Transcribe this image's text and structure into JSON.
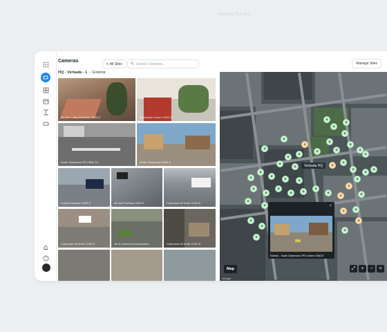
{
  "watermark": "Verkada The Bird",
  "app": {
    "title": "Cameras",
    "sites_label": "All Sites",
    "search_placeholder": "Search Cameras...",
    "manage_label": "Manage Sites"
  },
  "breadcrumb": {
    "site": "HQ - Verkada - 1",
    "separator": "›",
    "area": "Exterior"
  },
  "sidebar": {
    "icons": [
      "grid-icon",
      "camera-icon",
      "layers-icon",
      "archive-icon",
      "network-icon",
      "car-icon"
    ],
    "bottom_icons": [
      "bell-icon",
      "help-icon"
    ]
  },
  "cameras": [
    {
      "name": "4th Ave Lobby Entrance CD52-E"
    },
    {
      "name": "Claremont Corner CD52-E"
    },
    {
      "name": "South Claremont PR CB62-TE"
    },
    {
      "name": "South Claremont CD52-E"
    },
    {
      "name": "Lobby Entrance CD52-E"
    },
    {
      "name": "4th Ave Parking CD52-E"
    },
    {
      "name": "Claremont St North CH52-E"
    },
    {
      "name": "Claremont St North CH52-E"
    },
    {
      "name": "4th & Claremont Intersection"
    },
    {
      "name": "Claremont St North CH52-E"
    }
  ],
  "map": {
    "hq_label": "Verkada HQ",
    "popup_caption": "Exterior - South Claremont LPR Context CB62-E",
    "toggle_label": "Map",
    "attribution": "Google",
    "controls": [
      "fullscreen-icon",
      "zoom-in-icon",
      "zoom-out-icon",
      "close-icon"
    ]
  },
  "colors": {
    "accent": "#1e88e5",
    "pin_green": "#d9f2de",
    "pin_orange": "#f6e2c1"
  }
}
